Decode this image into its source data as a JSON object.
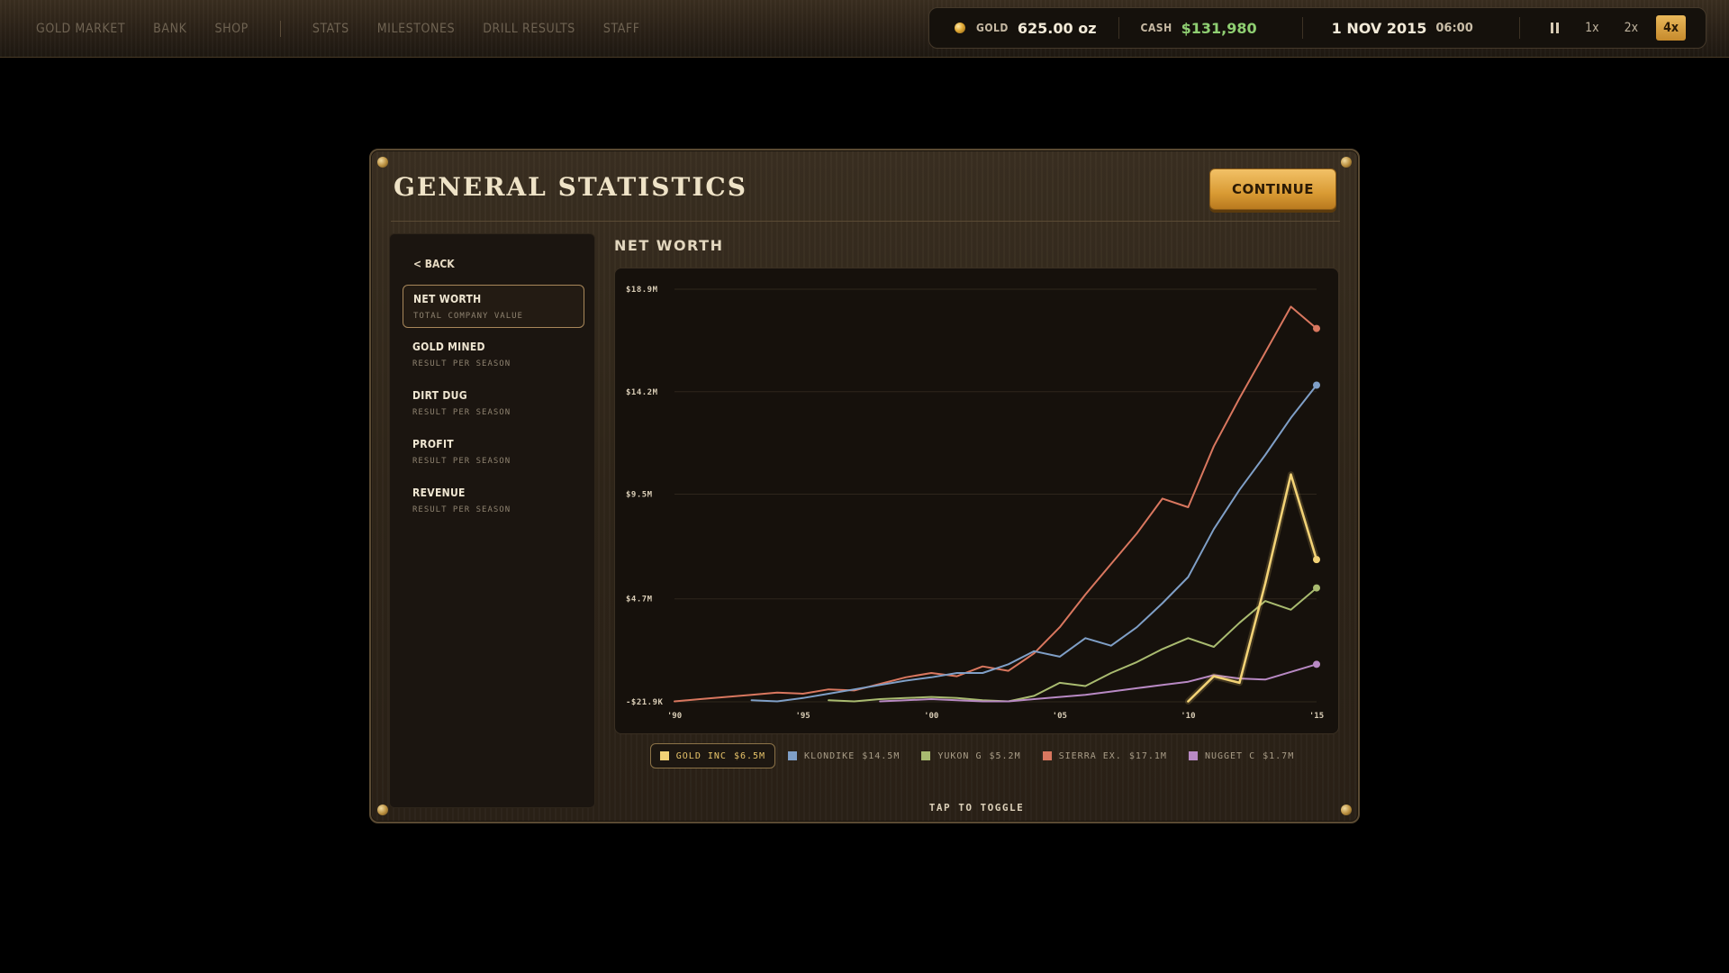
{
  "nav": {
    "items": [
      "GOLD MARKET",
      "BANK",
      "SHOP",
      "STATS",
      "MILESTONES",
      "DRILL RESULTS",
      "STAFF"
    ]
  },
  "hud": {
    "gold_label": "GOLD",
    "gold_value": "625.00 oz",
    "cash_label": "CASH",
    "cash_value": "$131,980",
    "date": "1 NOV 2015",
    "time": "06:00",
    "speeds": [
      "1x",
      "2x",
      "4x"
    ],
    "active_speed": "4x",
    "icons": {
      "gold": "gold-coin-icon",
      "pause": "pause-icon"
    }
  },
  "panel": {
    "title": "GENERAL STATISTICS",
    "continue_label": "CONTINUE",
    "back_label": "< BACK",
    "chart_heading": "NET WORTH",
    "tap_hint": "TAP TO TOGGLE"
  },
  "sidebar": {
    "items": [
      {
        "title": "NET WORTH",
        "sub": "TOTAL COMPANY VALUE",
        "active": true
      },
      {
        "title": "GOLD MINED",
        "sub": "RESULT PER SEASON",
        "active": false
      },
      {
        "title": "DIRT DUG",
        "sub": "RESULT PER SEASON",
        "active": false
      },
      {
        "title": "PROFIT",
        "sub": "RESULT PER SEASON",
        "active": false
      },
      {
        "title": "REVENUE",
        "sub": "RESULT PER SEASON",
        "active": false
      }
    ]
  },
  "legend": [
    {
      "name": "GOLD INC",
      "value": "$6.5M",
      "color": "#f2d276",
      "active": true
    },
    {
      "name": "KLONDIKE",
      "value": "$14.5M",
      "color": "#7f9fc7",
      "active": false
    },
    {
      "name": "YUKON G",
      "value": "$5.2M",
      "color": "#a9bb70",
      "active": false
    },
    {
      "name": "SIERRA EX.",
      "value": "$17.1M",
      "color": "#d9775f",
      "active": false
    },
    {
      "name": "NUGGET C",
      "value": "$1.7M",
      "color": "#b889c4",
      "active": false
    }
  ],
  "chart_data": {
    "type": "line",
    "title": "NET WORTH",
    "xlabel": "",
    "ylabel": "",
    "xlim": [
      1990,
      2015
    ],
    "ylim": [
      -0.0219,
      18.9
    ],
    "x_ticks": [
      1990,
      1995,
      2000,
      2005,
      2010,
      2015
    ],
    "x_tick_labels": [
      "'90",
      "'95",
      "'00",
      "'05",
      "'10",
      "'15"
    ],
    "y_ticks": [
      -0.0219,
      4.7,
      9.5,
      14.2,
      18.9
    ],
    "y_tick_labels": [
      "-$21.9K",
      "$4.7M",
      "$9.5M",
      "$14.2M",
      "$18.9M"
    ],
    "grid": true,
    "legend_position": "bottom",
    "series": [
      {
        "name": "SIERRA EX.",
        "color": "#d9775f",
        "x": [
          1990,
          1991,
          1992,
          1993,
          1994,
          1995,
          1996,
          1997,
          1998,
          1999,
          2000,
          2001,
          2002,
          2003,
          2004,
          2005,
          2006,
          2007,
          2008,
          2009,
          2010,
          2011,
          2012,
          2013,
          2014,
          2015
        ],
        "y": [
          0.0,
          0.1,
          0.2,
          0.3,
          0.4,
          0.35,
          0.55,
          0.5,
          0.8,
          1.1,
          1.3,
          1.15,
          1.6,
          1.4,
          2.2,
          3.4,
          4.9,
          6.3,
          7.7,
          9.3,
          8.9,
          11.7,
          13.9,
          16.0,
          18.1,
          17.1
        ]
      },
      {
        "name": "KLONDIKE",
        "color": "#7f9fc7",
        "x": [
          1993,
          1994,
          1995,
          1996,
          1997,
          1998,
          1999,
          2000,
          2001,
          2002,
          2003,
          2004,
          2005,
          2006,
          2007,
          2008,
          2009,
          2010,
          2011,
          2012,
          2013,
          2014,
          2015
        ],
        "y": [
          0.05,
          0.0,
          0.15,
          0.35,
          0.55,
          0.75,
          0.95,
          1.1,
          1.3,
          1.3,
          1.7,
          2.3,
          2.05,
          2.9,
          2.55,
          3.4,
          4.5,
          5.7,
          7.9,
          9.7,
          11.3,
          13.0,
          14.5
        ]
      },
      {
        "name": "YUKON G",
        "color": "#a9bb70",
        "x": [
          1996,
          1997,
          1998,
          1999,
          2000,
          2001,
          2002,
          2003,
          2004,
          2005,
          2006,
          2007,
          2008,
          2009,
          2010,
          2011,
          2012,
          2013,
          2014,
          2015
        ],
        "y": [
          0.05,
          0.0,
          0.1,
          0.15,
          0.2,
          0.15,
          0.05,
          0.0,
          0.25,
          0.85,
          0.7,
          1.3,
          1.8,
          2.4,
          2.9,
          2.5,
          3.6,
          4.6,
          4.2,
          5.2
        ]
      },
      {
        "name": "NUGGET C",
        "color": "#b889c4",
        "x": [
          1998,
          1999,
          2000,
          2001,
          2002,
          2003,
          2004,
          2005,
          2006,
          2007,
          2008,
          2009,
          2010,
          2011,
          2012,
          2013,
          2014,
          2015
        ],
        "y": [
          0.0,
          0.05,
          0.1,
          0.05,
          0.0,
          0.0,
          0.1,
          0.2,
          0.3,
          0.45,
          0.6,
          0.75,
          0.9,
          1.2,
          1.05,
          1.0,
          1.35,
          1.7
        ]
      },
      {
        "name": "GOLD INC",
        "color": "#f2d276",
        "x": [
          2010,
          2011,
          2012,
          2013,
          2014,
          2015
        ],
        "y": [
          0.0,
          1.15,
          0.85,
          5.4,
          10.4,
          6.5
        ]
      }
    ]
  }
}
